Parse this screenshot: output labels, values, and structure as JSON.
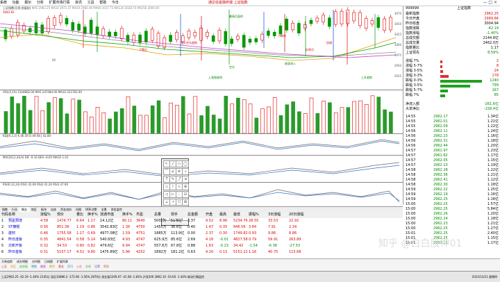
{
  "titlebar": {
    "menu": [
      "系统",
      "功能",
      "报价",
      "分析",
      "扩展市场行情",
      "资讯",
      "工具",
      "帮助",
      "今日"
    ],
    "center_title": "通达信金融终端 上证指数",
    "window_controls": [
      "—",
      "□",
      "×"
    ]
  },
  "chart": {
    "main_label": "上证指数(日线 前复权)",
    "indicator_label": "MA5 2962.25 MA10 2971.37 MA20 2983.49 MA60 3017.73 MA120 3028.75 MA250 3000.00",
    "top_price": "3083.83",
    "bottom_price": "60",
    "volume_label": "VOL(5,10) 2144862.00 MA5 247484.00 MA10 221783.00",
    "kdj_label": "KDJ(9,3,3) K 46.59 D 49.06 J 42.80",
    "macd_label": "MACD(12,26,9) DIF -9.16 DEA -8.65 MACD 1.01",
    "rsi_label": "RSI(6,12,24) RSI1 41.00 RSI2 41.20 RSI3 47.90",
    "y_ticks": [
      "3070",
      "3050",
      "3025",
      "3000",
      "2975",
      "2950",
      "2925"
    ],
    "annotations": [
      "最高后面的",
      "多头空头趋势",
      "上涨和底线",
      "下跌的",
      "底部进入",
      "回调",
      "上升趋势",
      "下跌后",
      "空头",
      "反转点"
    ]
  },
  "rightpanel": {
    "code": "999999",
    "name": "上证指数",
    "rows": [
      {
        "label": "最新指数",
        "value": "2962.25",
        "cls": "red"
      },
      {
        "label": "今日开盘",
        "value": "2999.84",
        "cls": "red"
      },
      {
        "label": "昨日收盘",
        "value": "3004.94",
        "cls": ""
      },
      {
        "label": "指数涨跌",
        "value": "-42.19",
        "cls": "green"
      },
      {
        "label": "指数涨幅",
        "value": "-1.40%",
        "cls": "green"
      },
      {
        "label": "总成交额",
        "value": "2144.8亿",
        "cls": ""
      },
      {
        "label": "总成交量",
        "value": "2462.0万",
        "cls": ""
      },
      {
        "label": "指数量比",
        "value": "1.17",
        "cls": ""
      },
      {
        "label": "上证领先",
        "value": "8.59%",
        "cls": "green"
      }
    ],
    "breadth": [
      {
        "label": "涨幅 7%",
        "value": "2",
        "cls": "red"
      },
      {
        "label": "涨幅 5-7%",
        "value": "8",
        "cls": "red"
      },
      {
        "label": "涨幅 3-5%",
        "value": "24",
        "cls": "red"
      },
      {
        "label": "涨幅 0-3%",
        "value": "178",
        "cls": "red"
      },
      {
        "label": "跌幅 0-3%",
        "value": "1240",
        "cls": "green"
      },
      {
        "label": "跌幅 3-5%",
        "value": "799",
        "cls": "green"
      },
      {
        "label": "跌幅 5-7%",
        "value": "167",
        "cls": "green"
      },
      {
        "label": "跌幅 7%",
        "value": "85",
        "cls": "green"
      }
    ],
    "flow": [
      {
        "label": "净流入额",
        "value": "-261.6亿",
        "cls": "green"
      },
      {
        "label": "大单净比",
        "value": "-158.4亿",
        "cls": "green"
      }
    ],
    "ticks": [
      {
        "time": "14:55",
        "price": "2962.17",
        "vol": "1.34亿"
      },
      {
        "time": "14:55",
        "price": "2962.01",
        "vol": "1.21亿"
      },
      {
        "time": "14:55",
        "price": "2962.09",
        "vol": "1.22亿"
      },
      {
        "time": "14:56",
        "price": "2962.11",
        "vol": "1.24亿"
      },
      {
        "time": "14:56",
        "price": "2962.23",
        "vol": "1.16亿"
      },
      {
        "time": "14:56",
        "price": "2962.31",
        "vol": "1.18亿"
      },
      {
        "time": "14:56",
        "price": "2962.44",
        "vol": "1.20亿"
      },
      {
        "time": "14:57",
        "price": "2961.97",
        "vol": "1.23亿"
      },
      {
        "time": "14:57",
        "price": "2961.82",
        "vol": "1.17亿"
      },
      {
        "time": "14:57",
        "price": "2962.05",
        "vol": "1.15亿"
      },
      {
        "time": "14:57",
        "price": "2962.13",
        "vol": "1.19亿"
      },
      {
        "time": "14:58",
        "price": "2962.28",
        "vol": "1.22亿"
      },
      {
        "time": "14:58",
        "price": "2962.36",
        "vol": "1.21亿"
      },
      {
        "time": "14:58",
        "price": "2962.41",
        "vol": "1.12亿"
      },
      {
        "time": "14:58",
        "price": "2962.30",
        "vol": "1.18亿"
      },
      {
        "time": "14:59",
        "price": "2962.22",
        "vol": "1.25亿"
      },
      {
        "time": "14:59",
        "price": "2962.19",
        "vol": "1.16亿"
      },
      {
        "time": "14:59",
        "price": "2962.25",
        "vol": "1.18亿"
      },
      {
        "time": "15:00",
        "price": "2962.25",
        "vol": "1.57亿"
      },
      {
        "time": "15:00",
        "price": "2962.25",
        "vol": "5.84亿"
      },
      {
        "time": "15:00",
        "price": "2962.26",
        "vol": "1.20亿"
      },
      {
        "time": "15:00",
        "price": "2962.24",
        "vol": "1.18亿"
      },
      {
        "time": "15:00",
        "price": "2962.23",
        "vol": "1.21亿"
      },
      {
        "time": "15:00",
        "price": "2962.25",
        "vol": "1.27亿"
      },
      {
        "time": "15:01",
        "price": "2962.25",
        "vol": "2.40亿"
      },
      {
        "time": "15:01",
        "price": "2962.25",
        "vol": "1.15亿"
      },
      {
        "time": "15:01",
        "price": "2962.25",
        "vol": "1.17亿"
      }
    ]
  },
  "tabs": [
    "指数",
    "行业",
    "概念",
    "地区",
    "板块",
    "自选",
    "资金流向",
    "风格",
    "DDE决策",
    "全景",
    "资金监控"
  ],
  "table": {
    "headers": [
      "代码",
      "名称",
      "涨幅%",
      "现价",
      "量比",
      "换手%",
      "流通市值",
      "换手%",
      "市盈",
      "总量",
      "现手",
      "总金额",
      "开盘",
      "最高",
      "最低",
      "振幅%",
      "3日涨幅",
      "20日涨幅"
    ],
    "rows": [
      [
        "1",
        "预盈预增",
        "4.58",
        "1474.77",
        "6.64",
        "1.17",
        "14.12亿",
        "80.11",
        "3640",
        "5002万",
        "51.8亿",
        "3.37",
        "9.52",
        "8.96",
        "5234.76",
        "28.55",
        "33.53",
        "22.92"
      ],
      [
        "2",
        "ST摘帽",
        "0.56",
        "851.36",
        "1.19",
        "0.86",
        "3542.83亿",
        "1.36",
        "4750",
        "1455万",
        "36.6亿",
        "0.40",
        "1.47",
        "0.35",
        "846.56",
        "3.84",
        "7.91",
        "2.34"
      ],
      [
        "3",
        "建材",
        "0.46",
        "1755.58",
        "1.17",
        "0.69",
        "4977.08亿",
        "1.59",
        "4751",
        "1885万",
        "113.9亿",
        "0.00",
        "2.37",
        "0.30",
        "1749.82",
        "0.93",
        "9.86",
        "8.86"
      ],
      [
        "4",
        "昨日连板",
        "0.35",
        "4841.54",
        "0.58",
        "5.14",
        "540.83亿",
        "4.93",
        "4747",
        "625.9万",
        "85.6亿",
        "2.69",
        "4.18",
        "-0.01",
        "4827.58",
        "0.79",
        "59.91",
        "263.89"
      ],
      [
        "5",
        "次新开板",
        "0.32",
        "34.53",
        "0.80",
        "0.82",
        "479.6亿",
        "9.94",
        "4747",
        "557.6万",
        "67.8亿",
        "0.88",
        "1.63",
        "-0.23",
        "34.42",
        "-1.54",
        "-6.38",
        "-27.53"
      ],
      [
        "6",
        "昨日首板",
        "0.31",
        "5157.17",
        "4.52",
        "9.80",
        "1475.89亿",
        "5.96",
        "4252",
        "1892万",
        "181.2亿",
        "0.63",
        "4.16",
        "0.13",
        "5151.22",
        "1.16",
        "40.75",
        "115.68"
      ]
    ]
  },
  "bottombar": {
    "tabs": [
      "大单追踪",
      "成交明细",
      "分时图",
      "日线图",
      "扩展列表"
    ],
    "icons": [
      "上证",
      "深证",
      "创业板",
      "港股",
      "美股",
      "期货",
      "基金",
      "资讯",
      "公告",
      "交易",
      "设置",
      "帮助"
    ]
  },
  "statusbar": {
    "text": "上证2962.25 -42.19 -1.40% 2145亿  深证10886.2 -172.06 -1.56% 2870亿  创业板2209.07 -41.08 -1.83%  沪深300 3892.10 -54.60 -1.40%  联动行情监控",
    "time": "2023/12/21 星期四"
  },
  "watermark": "知乎 @白白股神01"
}
